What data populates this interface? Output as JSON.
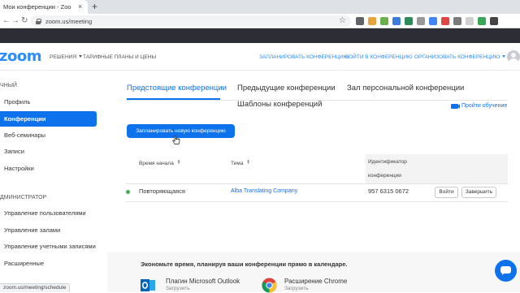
{
  "browser": {
    "tab_title": "Мои конференции - Zoom",
    "tab_close_glyph": "×",
    "new_tab_glyph": "+",
    "back_glyph": "←",
    "forward_glyph": "→",
    "reload_glyph": "↻",
    "url": "zoom.us/meeting",
    "star_glyph": "☆",
    "extension_colors": [
      "#5f6368",
      "#e8a33d",
      "#6ab04c",
      "#3b7ddd",
      "#2e8b57",
      "#999999",
      "#4285f4",
      "#e04545",
      "#7a7a7a",
      "#d0d0d0",
      "#3aa757",
      "#444444"
    ]
  },
  "topnav": {
    "logo": "zoom",
    "solutions": "РЕШЕНИЯ",
    "plans": "ТАРИФНЫЕ ПЛАНЫ И ЦЕНЫ",
    "schedule": "ЗАПЛАНИРОВАТЬ КОНФЕРЕНЦИЮ",
    "join": "ВОЙТИ В КОНФЕРЕНЦИЮ",
    "host": "ОРГАНИЗОВАТЬ КОНФЕРЕНЦИЮ"
  },
  "sidebar": {
    "personal_heading": "ЧНЫЙ",
    "items": [
      {
        "label": "Профиль"
      },
      {
        "label": "Конференции",
        "active": true
      },
      {
        "label": "Веб-семинары"
      },
      {
        "label": "Записи"
      },
      {
        "label": "Настройки"
      }
    ],
    "admin_heading": "ДМИНИСТРАТОР",
    "admin_items": [
      {
        "label": "Управление пользователями"
      },
      {
        "label": "Управление залами"
      },
      {
        "label": "Управление учетными записями"
      },
      {
        "label": "Расширенные"
      }
    ]
  },
  "main": {
    "tabs": [
      {
        "label": "Предстоящие конференции",
        "active": true
      },
      {
        "label": "Предыдущие конференции"
      },
      {
        "label": "Зал персональной конференции"
      },
      {
        "label": "Шаблоны конференций"
      }
    ],
    "tutorial_link": "Пройти обучение",
    "schedule_button": "Запланировать новую конференцию",
    "table": {
      "headers": {
        "start_time": "Время начала",
        "topic": "Тема",
        "id_line1": "Идентификатор",
        "id_line2": "конференции"
      },
      "rows": [
        {
          "status_color": "#3fb350",
          "start_time": "Повторяющаяся",
          "topic": "Alba Translating Company",
          "meeting_id": "957 6315 0672",
          "start_button": "Войти",
          "end_button": "Завершить"
        }
      ]
    },
    "promo": {
      "title": "Экономьте время, планируя ваши конференции прямо в календаре.",
      "plugins": [
        {
          "name": "Плагин Microsoft Outlook",
          "action": "Загрузить"
        },
        {
          "name": "Расширение Chrome",
          "action": "Загрузить"
        }
      ]
    }
  },
  "statusbar": {
    "url": "zoom.us/meeting/schedule"
  }
}
